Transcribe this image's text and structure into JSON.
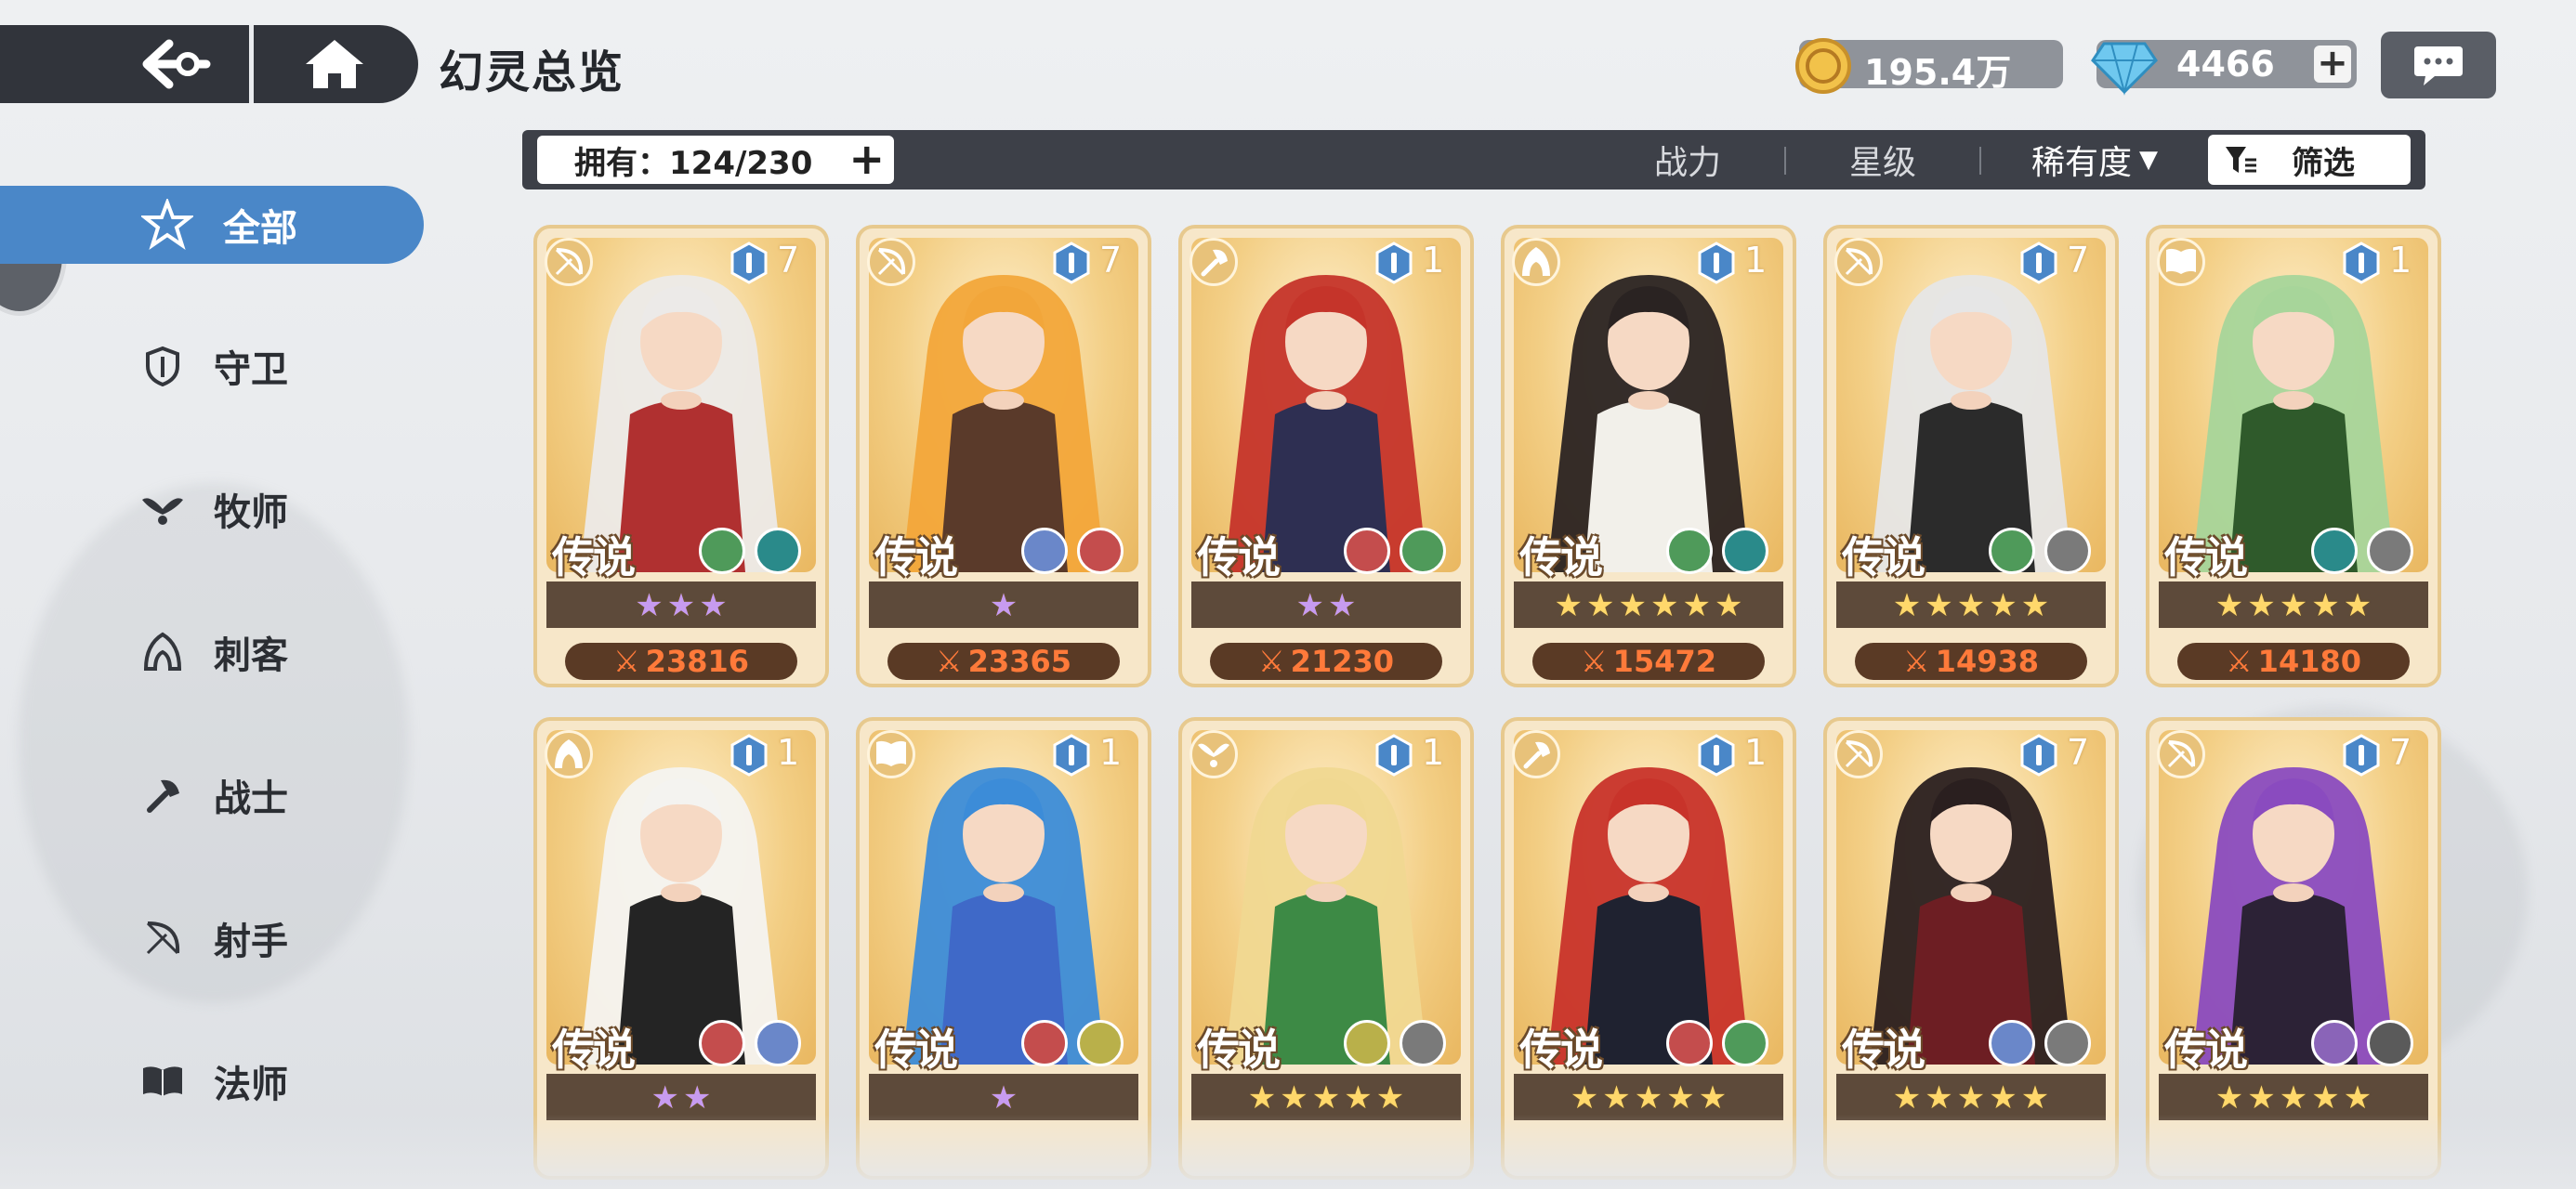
{
  "header": {
    "title": "幻灵总览",
    "gold": "195.4万",
    "diamonds": "4466",
    "back_icon": "back-arrow-icon",
    "home_icon": "home-icon",
    "chat_icon": "chat-bubble-icon"
  },
  "sidebar": {
    "items": [
      {
        "label": "全部",
        "icon": "star-all-icon",
        "active": true
      },
      {
        "label": "守卫",
        "icon": "shield-icon"
      },
      {
        "label": "牧师",
        "icon": "priest-wings-icon"
      },
      {
        "label": "刺客",
        "icon": "assassin-hood-icon"
      },
      {
        "label": "战士",
        "icon": "warrior-axe-icon"
      },
      {
        "label": "射手",
        "icon": "archer-bow-icon"
      },
      {
        "label": "法师",
        "icon": "mage-book-icon"
      }
    ]
  },
  "toolbar": {
    "owned": "拥有：124/230",
    "sort_power": "战力",
    "sort_stars": "星级",
    "sort_rarity": "稀有度",
    "filter_label": "筛选"
  },
  "colors": {
    "accent_blue": "#4a87c8",
    "card_bg": "#f7e7c9",
    "power_text": "#ff7a3a",
    "dark_bar": "#3d4048"
  },
  "cards": [
    {
      "class": "archer",
      "level": "7",
      "rarity": "传说",
      "stars": 3,
      "star_color": "purple",
      "power": "23816",
      "elements": [
        "#4f9a5a",
        "#2a8a8a"
      ],
      "hair": "#eceae8",
      "outfit": "#b03030"
    },
    {
      "class": "archer",
      "level": "7",
      "rarity": "传说",
      "stars": 1,
      "star_color": "purple",
      "power": "23365",
      "elements": [
        "#6a87c9",
        "#c44d4d"
      ],
      "hair": "#f2a63a",
      "outfit": "#5a3a2a"
    },
    {
      "class": "warrior",
      "level": "1",
      "rarity": "传说",
      "stars": 2,
      "star_color": "purple",
      "power": "21230",
      "elements": [
        "#c44d4d",
        "#4f9a5a"
      ],
      "hair": "#c5342a",
      "outfit": "#2e2f52"
    },
    {
      "class": "assassin",
      "level": "1",
      "rarity": "传说",
      "stars": 6,
      "star_color": "gold",
      "power": "15472",
      "elements": [
        "#4f9a5a",
        "#2a8a8a"
      ],
      "hair": "#2a2322",
      "outfit": "#f2f0ea"
    },
    {
      "class": "archer",
      "level": "7",
      "rarity": "传说",
      "stars": 5,
      "star_color": "gold",
      "power": "14938",
      "elements": [
        "#4f9a5a",
        "#7a7a7a"
      ],
      "hair": "#e6e6e6",
      "outfit": "#2b2b2b"
    },
    {
      "class": "mage",
      "level": "1",
      "rarity": "传说",
      "stars": 5,
      "star_color": "gold",
      "power": "14180",
      "elements": [
        "#2a8a8a",
        "#7a7a7a"
      ],
      "hair": "#a7d59a",
      "outfit": "#2f5a2b"
    },
    {
      "class": "assassin",
      "level": "1",
      "rarity": "传说",
      "stars": 2,
      "star_color": "purple",
      "power": "",
      "elements": [
        "#c44d4d",
        "#6a87c9"
      ],
      "hair": "#f4f3f0",
      "outfit": "#242424"
    },
    {
      "class": "mage",
      "level": "1",
      "rarity": "传说",
      "stars": 1,
      "star_color": "purple",
      "power": "",
      "elements": [
        "#c44d4d",
        "#b9b04a"
      ],
      "hair": "#3c8cd8",
      "outfit": "#3f69c8"
    },
    {
      "class": "priest",
      "level": "1",
      "rarity": "传说",
      "stars": 5,
      "star_color": "gold",
      "power": "",
      "elements": [
        "#b9b04a",
        "#7a7a7a"
      ],
      "hair": "#f0d891",
      "outfit": "#3d8a45"
    },
    {
      "class": "warrior",
      "level": "1",
      "rarity": "传说",
      "stars": 5,
      "star_color": "gold",
      "power": "",
      "elements": [
        "#c44d4d",
        "#4f9a5a"
      ],
      "hair": "#c8332a",
      "outfit": "#1f2230"
    },
    {
      "class": "archer",
      "level": "7",
      "rarity": "传说",
      "stars": 5,
      "star_color": "gold",
      "power": "",
      "elements": [
        "#6a87c9",
        "#7a7a7a"
      ],
      "hair": "#2a1f1f",
      "outfit": "#6d1e23"
    },
    {
      "class": "archer",
      "level": "7",
      "rarity": "传说",
      "stars": 5,
      "star_color": "gold",
      "power": "",
      "elements": [
        "#8a64b8",
        "#5a5a5a"
      ],
      "hair": "#8a4bbf",
      "outfit": "#2c2236"
    }
  ]
}
